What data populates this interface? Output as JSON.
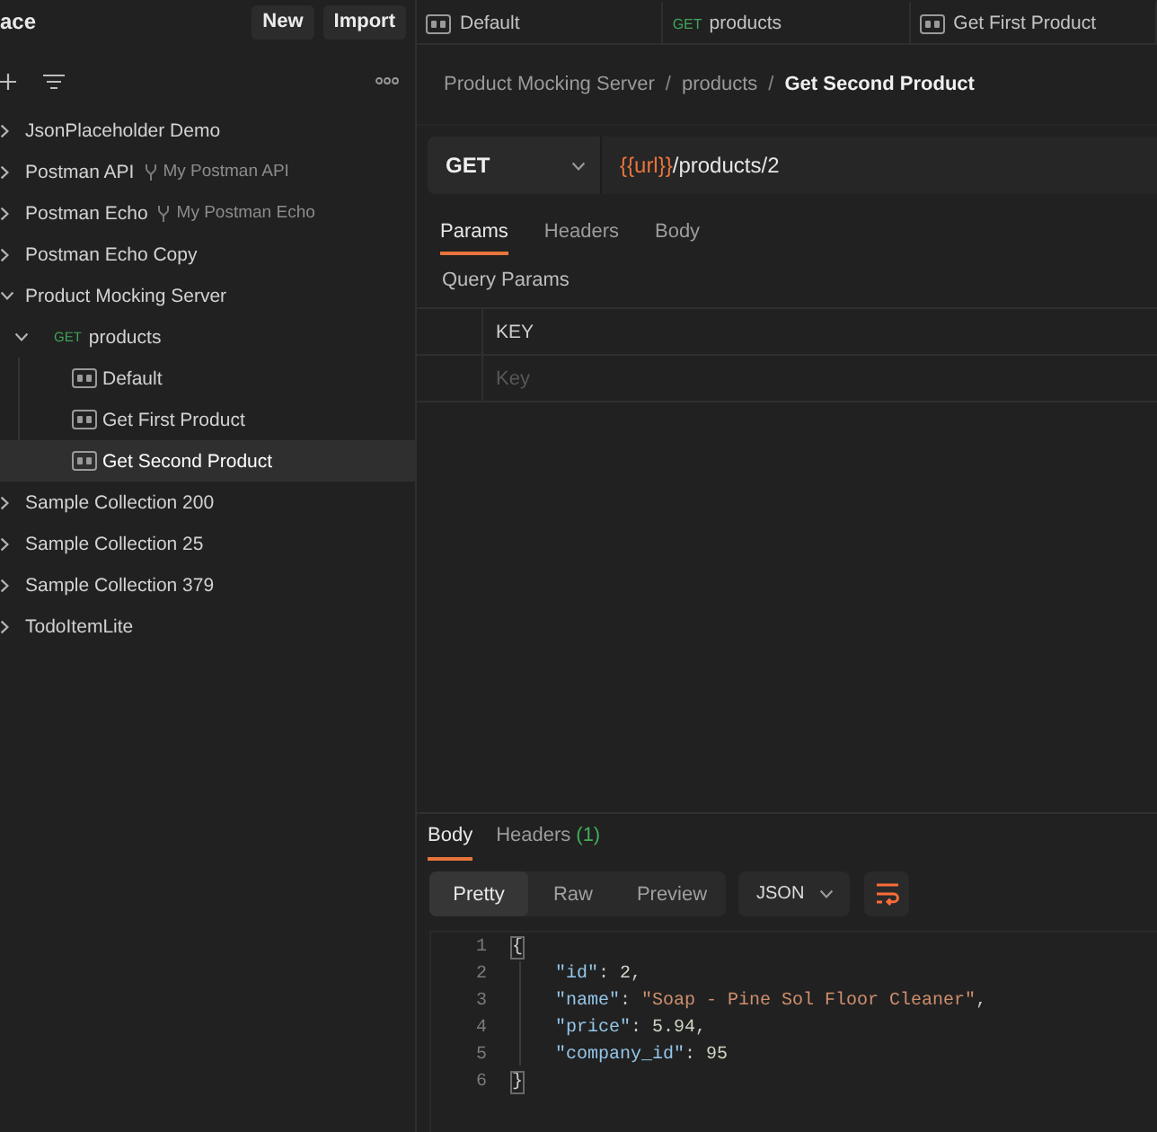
{
  "sidebar": {
    "title": "ace",
    "buttons": [
      "New",
      "Import"
    ],
    "tree": [
      {
        "kind": "collection",
        "label": "JsonPlaceholder Demo",
        "expanded": false,
        "selected": false
      },
      {
        "kind": "collection",
        "label": "Postman API",
        "fork": "My Postman API",
        "expanded": false,
        "selected": false
      },
      {
        "kind": "collection",
        "label": "Postman Echo",
        "fork": "My Postman Echo",
        "expanded": false,
        "selected": false
      },
      {
        "kind": "collection",
        "label": "Postman Echo Copy",
        "expanded": false,
        "selected": false
      },
      {
        "kind": "collection",
        "label": "Product Mocking Server",
        "expanded": true,
        "selected": false,
        "children": [
          {
            "kind": "request",
            "method": "GET",
            "label": "products",
            "expanded": true,
            "selected": false,
            "children": [
              {
                "kind": "example",
                "label": "Default",
                "selected": false
              },
              {
                "kind": "example",
                "label": "Get First Product",
                "selected": false
              },
              {
                "kind": "example",
                "label": "Get Second Product",
                "selected": true
              }
            ]
          }
        ]
      },
      {
        "kind": "collection",
        "label": "Sample Collection 200",
        "expanded": false,
        "selected": false
      },
      {
        "kind": "collection",
        "label": "Sample Collection 25",
        "expanded": false,
        "selected": false
      },
      {
        "kind": "collection",
        "label": "Sample Collection 379",
        "expanded": false,
        "selected": false
      },
      {
        "kind": "collection",
        "label": "TodoItemLite",
        "expanded": false,
        "selected": false
      }
    ]
  },
  "tabs": [
    {
      "kind": "example",
      "label": "Default",
      "selected": false
    },
    {
      "kind": "request",
      "method": "GET",
      "label": "products",
      "selected": false
    },
    {
      "kind": "example",
      "label": "Get First Product",
      "selected": false
    }
  ],
  "request": {
    "breadcrumb": [
      {
        "kind": "link",
        "text": "Product Mocking Server"
      },
      {
        "kind": "separator",
        "text": "/"
      },
      {
        "kind": "link",
        "text": "products"
      },
      {
        "kind": "separator",
        "text": "/"
      },
      {
        "kind": "current",
        "text": "Get Second Product"
      }
    ],
    "method": "GET",
    "url": [
      {
        "kind": "variable",
        "text": "{{url}}"
      },
      {
        "kind": "path",
        "text": "/products/2"
      }
    ],
    "tabs": [
      {
        "label": "Params",
        "selected": true
      },
      {
        "label": "Headers",
        "selected": false
      },
      {
        "label": "Body",
        "selected": false
      }
    ],
    "params": {
      "title": "Query Params",
      "columns": [
        "KEY"
      ],
      "placeholder": "Key"
    }
  },
  "response": {
    "tabs": [
      {
        "label": "Body",
        "selected": true
      },
      {
        "label": "Headers",
        "count": "(1)",
        "selected": false
      }
    ],
    "views": [
      {
        "label": "Pretty",
        "selected": true
      },
      {
        "label": "Raw",
        "selected": false
      },
      {
        "label": "Preview",
        "selected": false
      }
    ],
    "format": "JSON",
    "code": [
      {
        "number": "1",
        "tokens": [
          {
            "kind": "bracket",
            "text": "{"
          }
        ]
      },
      {
        "number": "2",
        "tokens": [
          {
            "kind": "key",
            "text": "    \"id\""
          },
          {
            "kind": "punct",
            "text": ": "
          },
          {
            "kind": "number",
            "text": "2"
          },
          {
            "kind": "punct",
            "text": ","
          }
        ]
      },
      {
        "number": "3",
        "tokens": [
          {
            "kind": "key",
            "text": "    \"name\""
          },
          {
            "kind": "punct",
            "text": ": "
          },
          {
            "kind": "string",
            "text": "\"Soap - Pine Sol Floor Cleaner\""
          },
          {
            "kind": "punct",
            "text": ","
          }
        ]
      },
      {
        "number": "4",
        "tokens": [
          {
            "kind": "key",
            "text": "    \"price\""
          },
          {
            "kind": "punct",
            "text": ": "
          },
          {
            "kind": "number",
            "text": "5.94"
          },
          {
            "kind": "punct",
            "text": ","
          }
        ]
      },
      {
        "number": "5",
        "tokens": [
          {
            "kind": "key",
            "text": "    \"company_id\""
          },
          {
            "kind": "punct",
            "text": ": "
          },
          {
            "kind": "number",
            "text": "95"
          }
        ]
      },
      {
        "number": "6",
        "tokens": [
          {
            "kind": "bracket",
            "text": "}"
          }
        ]
      }
    ]
  }
}
